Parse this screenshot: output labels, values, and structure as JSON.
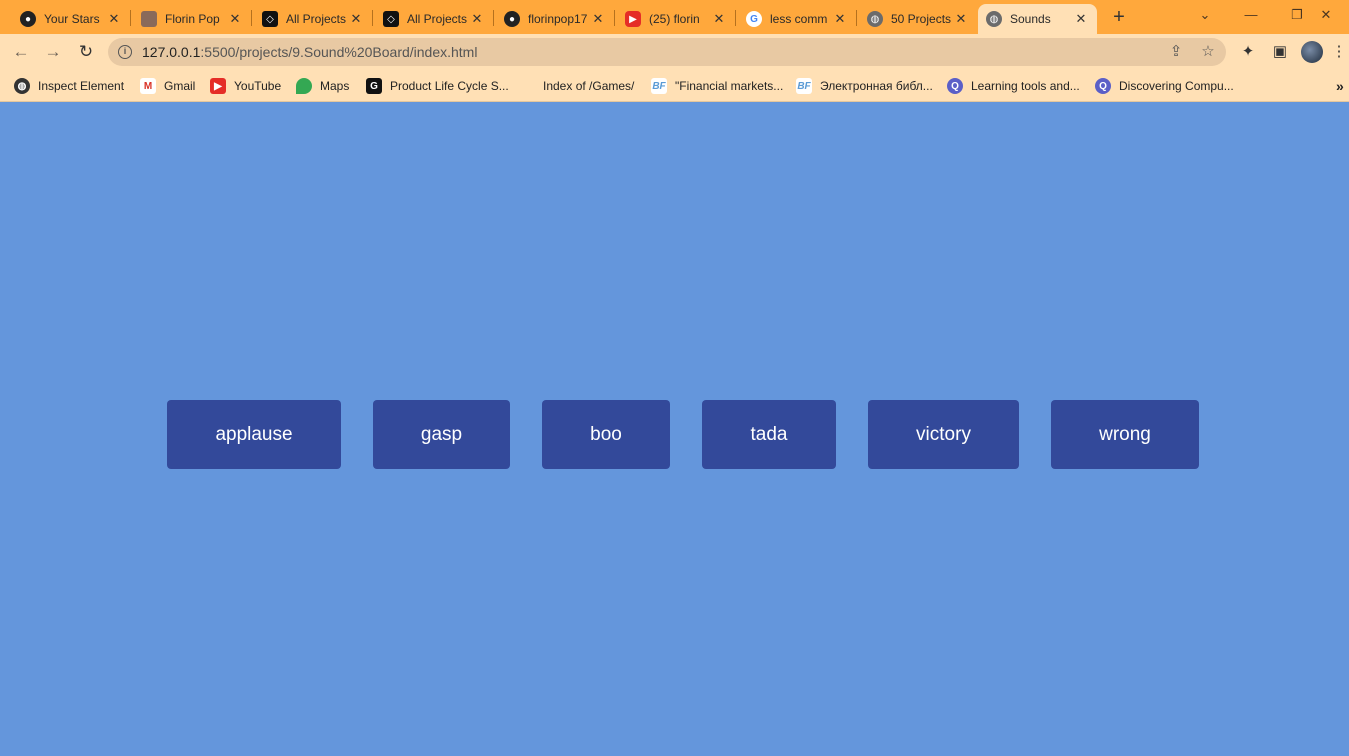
{
  "browser": {
    "tabs": [
      {
        "title": "Your Stars",
        "icon": "github-icon"
      },
      {
        "title": "Florin Pop",
        "icon": "avatar-icon"
      },
      {
        "title": "All Projects",
        "icon": "codepen-icon"
      },
      {
        "title": "All Projects",
        "icon": "codepen-icon"
      },
      {
        "title": "florinpop17",
        "icon": "github-icon"
      },
      {
        "title": "(25) florin",
        "icon": "youtube-icon"
      },
      {
        "title": "less comm",
        "icon": "google-icon"
      },
      {
        "title": "50 Projects",
        "icon": "globe-icon"
      },
      {
        "title": "Sounds",
        "icon": "globe-icon"
      }
    ],
    "active_tab_index": 8,
    "url_host": "127.0.0.1",
    "url_path": ":5500/projects/9.Sound%20Board/index.html",
    "bookmarks": [
      {
        "label": "Inspect Element",
        "icon": "globe-icon"
      },
      {
        "label": "Gmail",
        "icon": "gmail-icon"
      },
      {
        "label": "YouTube",
        "icon": "youtube-icon"
      },
      {
        "label": "Maps",
        "icon": "maps-icon"
      },
      {
        "label": "Product Life Cycle S...",
        "icon": "g-icon"
      },
      {
        "label": "Index of /Games/",
        "icon": "none"
      },
      {
        "label": "\"Financial markets...",
        "icon": "bf-icon"
      },
      {
        "label": "Электронная библ...",
        "icon": "bf-icon"
      },
      {
        "label": "Learning tools and...",
        "icon": "q-icon"
      },
      {
        "label": "Discovering Compu...",
        "icon": "q-icon"
      }
    ],
    "more_bookmarks": "»"
  },
  "colors": {
    "page_background": "#6496dc",
    "button_background": "#33499a",
    "tabstrip": "#ffa83c",
    "toolbar": "#ffe0b5"
  },
  "buttons": [
    {
      "label": "applause"
    },
    {
      "label": "gasp"
    },
    {
      "label": "boo"
    },
    {
      "label": "tada"
    },
    {
      "label": "victory"
    },
    {
      "label": "wrong"
    }
  ]
}
